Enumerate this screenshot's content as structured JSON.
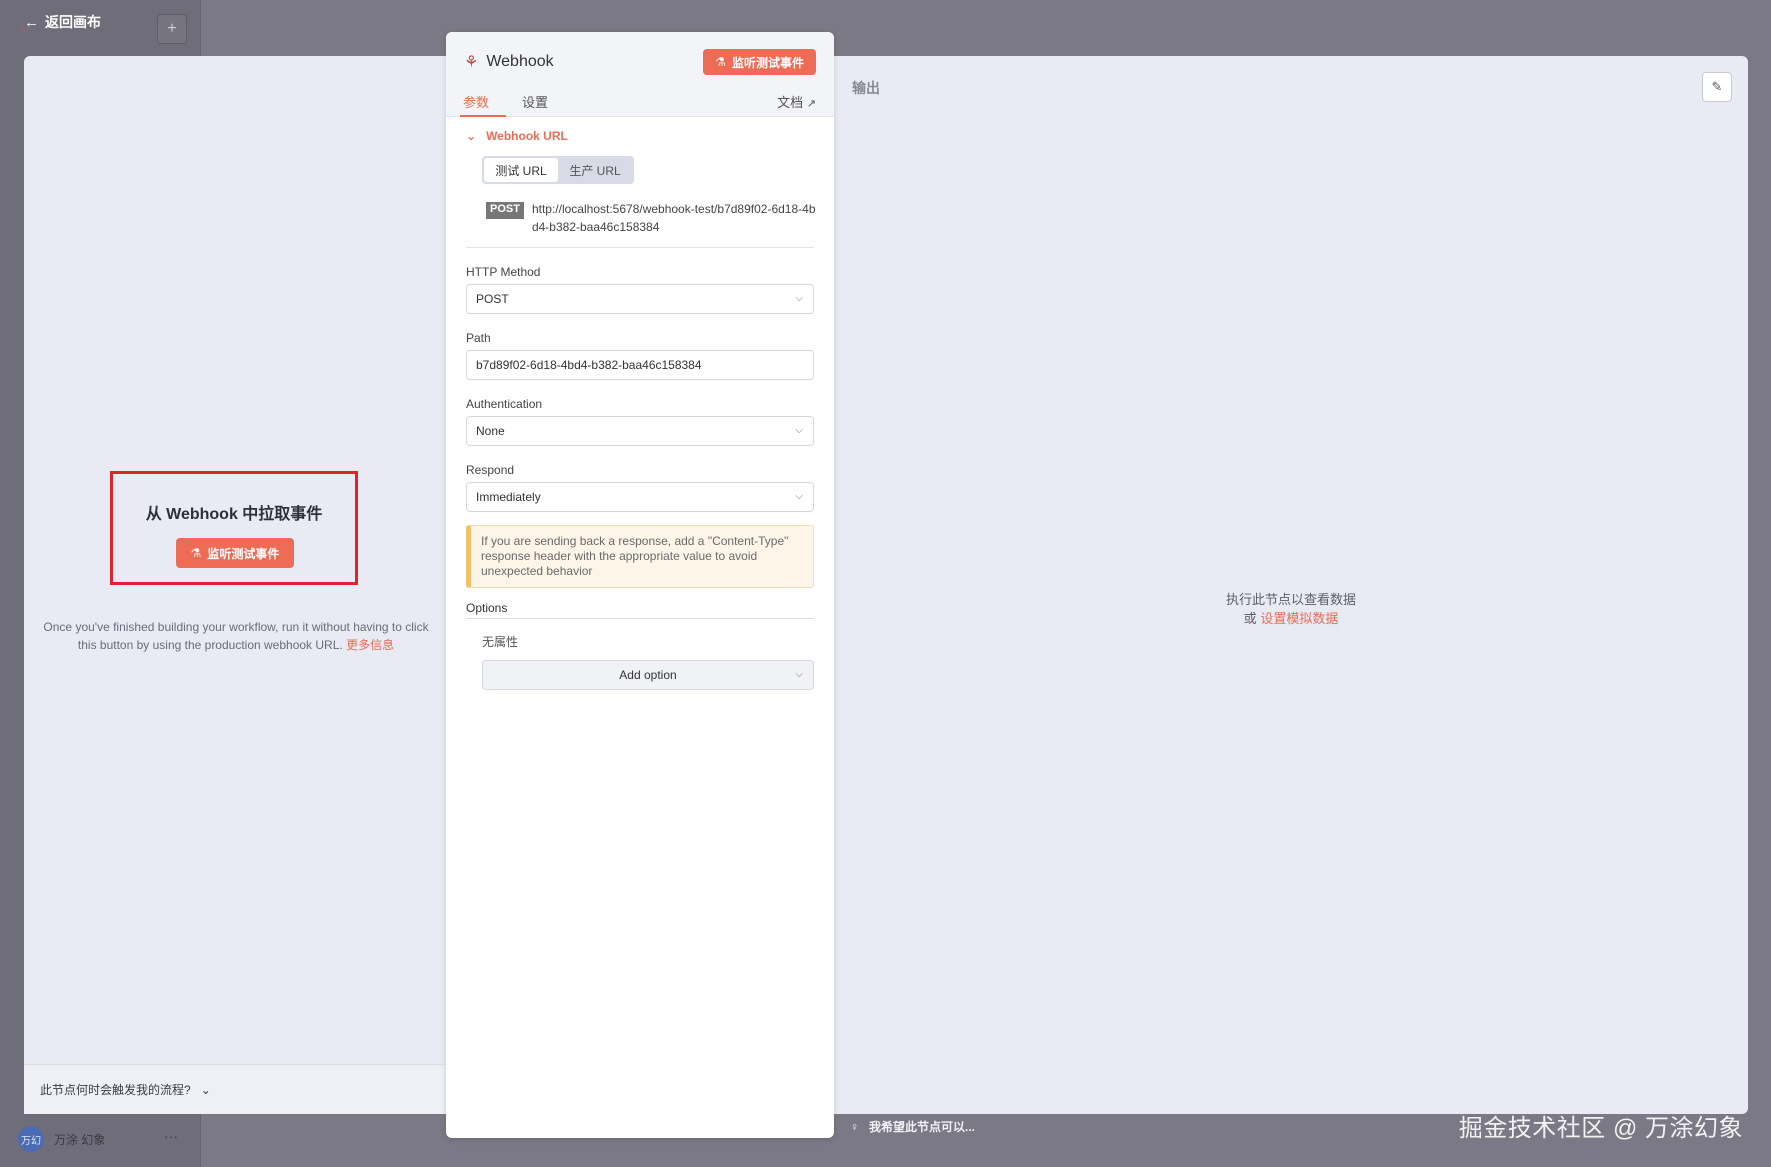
{
  "canvas": {
    "back_label": "返回画布",
    "add_symbol": "+",
    "user_initials": "万幻",
    "user_name": "万涂 幻象",
    "more_symbol": "···"
  },
  "input_pane": {
    "title": "从 Webhook 中拉取事件",
    "listen_button": "监听测试事件",
    "hint": "Once you've finished building your workflow, run it without having to click this button by using the production webhook URL.",
    "more_info_link": "更多信息",
    "trigger_question": "此节点何时会触发我的流程?"
  },
  "node": {
    "title": "Webhook",
    "listen_button": "监听测试事件",
    "tabs": [
      "参数",
      "设置"
    ],
    "docs_label": "文档",
    "webhook_url_section": "Webhook URL",
    "url_toggle": [
      "测试 URL",
      "生产 URL"
    ],
    "method_badge": "POST",
    "url": "http://localhost:5678/webhook-test/b7d89f02-6d18-4bd4-b382-baa46c158384",
    "http_method_label": "HTTP Method",
    "http_method_value": "POST",
    "path_label": "Path",
    "path_value": "b7d89f02-6d18-4bd4-b382-baa46c158384",
    "auth_label": "Authentication",
    "auth_value": "None",
    "respond_label": "Respond",
    "respond_value": "Immediately",
    "notice": "If you are sending back a response, add a \"Content-Type\" response header with the appropriate value to avoid unexpected behavior",
    "options_label": "Options",
    "no_properties": "无属性",
    "add_option": "Add option"
  },
  "output_pane": {
    "label": "输出",
    "empty_line1": "执行此节点以查看数据",
    "empty_or": "或",
    "mock_link": "设置模拟数据"
  },
  "footer": {
    "wish": "我希望此节点可以...",
    "watermark": "掘金技术社区 @ 万涂幻象"
  },
  "colors": {
    "accent": "#ee6b56",
    "highlight_frame": "#e0242c"
  }
}
